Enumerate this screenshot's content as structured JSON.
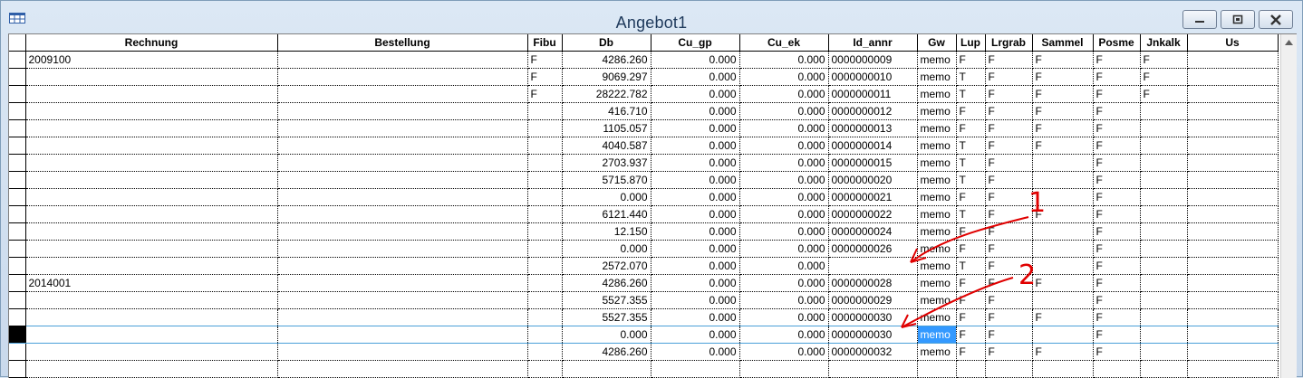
{
  "window": {
    "title": "Angebot1"
  },
  "columns": [
    "Rechnung",
    "Bestellung",
    "Fibu",
    "Db",
    "Cu_gp",
    "Cu_ek",
    "Id_annr",
    "Gw",
    "Lup",
    "Lrgrab",
    "Sammel",
    "Posme",
    "Jnkalk",
    "Us"
  ],
  "rows": [
    [
      "2009100",
      "",
      "F",
      "4286.260",
      "0.000",
      "0.000",
      "0000000009",
      "memo",
      "F",
      "F",
      "F",
      "F",
      "F",
      ""
    ],
    [
      "",
      "",
      "F",
      "9069.297",
      "0.000",
      "0.000",
      "0000000010",
      "memo",
      "T",
      "F",
      "F",
      "F",
      "F",
      ""
    ],
    [
      "",
      "",
      "F",
      "28222.782",
      "0.000",
      "0.000",
      "0000000011",
      "memo",
      "T",
      "F",
      "F",
      "F",
      "F",
      ""
    ],
    [
      "",
      "",
      "",
      "416.710",
      "0.000",
      "0.000",
      "0000000012",
      "memo",
      "F",
      "F",
      "F",
      "F",
      "",
      ""
    ],
    [
      "",
      "",
      "",
      "1105.057",
      "0.000",
      "0.000",
      "0000000013",
      "memo",
      "F",
      "F",
      "F",
      "F",
      "",
      ""
    ],
    [
      "",
      "",
      "",
      "4040.587",
      "0.000",
      "0.000",
      "0000000014",
      "memo",
      "T",
      "F",
      "F",
      "F",
      "",
      ""
    ],
    [
      "",
      "",
      "",
      "2703.937",
      "0.000",
      "0.000",
      "0000000015",
      "memo",
      "T",
      "F",
      "",
      "F",
      "",
      ""
    ],
    [
      "",
      "",
      "",
      "5715.870",
      "0.000",
      "0.000",
      "0000000020",
      "memo",
      "T",
      "F",
      "",
      "F",
      "",
      ""
    ],
    [
      "",
      "",
      "",
      "0.000",
      "0.000",
      "0.000",
      "0000000021",
      "memo",
      "F",
      "F",
      "",
      "F",
      "",
      ""
    ],
    [
      "",
      "",
      "",
      "6121.440",
      "0.000",
      "0.000",
      "0000000022",
      "memo",
      "T",
      "F",
      "F",
      "F",
      "",
      ""
    ],
    [
      "",
      "",
      "",
      "12.150",
      "0.000",
      "0.000",
      "0000000024",
      "memo",
      "F",
      "F",
      "",
      "F",
      "",
      ""
    ],
    [
      "",
      "",
      "",
      "0.000",
      "0.000",
      "0.000",
      "0000000026",
      "memo",
      "F",
      "F",
      "",
      "F",
      "",
      ""
    ],
    [
      "",
      "",
      "",
      "2572.070",
      "0.000",
      "0.000",
      "",
      "memo",
      "T",
      "F",
      "",
      "F",
      "",
      ""
    ],
    [
      "2014001",
      "",
      "",
      "4286.260",
      "0.000",
      "0.000",
      "0000000028",
      "memo",
      "F",
      "F",
      "F",
      "F",
      "",
      ""
    ],
    [
      "",
      "",
      "",
      "5527.355",
      "0.000",
      "0.000",
      "0000000029",
      "memo",
      "F",
      "F",
      "",
      "F",
      "",
      ""
    ],
    [
      "",
      "",
      "",
      "5527.355",
      "0.000",
      "0.000",
      "0000000030",
      "memo",
      "F",
      "F",
      "F",
      "F",
      "",
      ""
    ],
    [
      "",
      "",
      "",
      "0.000",
      "0.000",
      "0.000",
      "0000000030",
      "memo",
      "F",
      "F",
      "",
      "F",
      "",
      ""
    ],
    [
      "",
      "",
      "",
      "4286.260",
      "0.000",
      "0.000",
      "0000000032",
      "memo",
      "F",
      "F",
      "F",
      "F",
      "",
      ""
    ],
    [
      "",
      "",
      "",
      "",
      "",
      "",
      "",
      "",
      "",
      "",
      "",
      "",
      "",
      ""
    ]
  ],
  "current_row_index": 16,
  "highlighted_cell": {
    "row": 16,
    "col": 7
  },
  "annotations": [
    "1",
    "2"
  ],
  "colors": {
    "selection": "#3399ff",
    "annotation": "#e00000",
    "title_text": "#1e395b"
  },
  "icons": [
    "grid-app-icon",
    "minimize-icon",
    "maximize-icon",
    "close-icon",
    "scroll-up-arrow-icon",
    "record-pointer-icon"
  ]
}
